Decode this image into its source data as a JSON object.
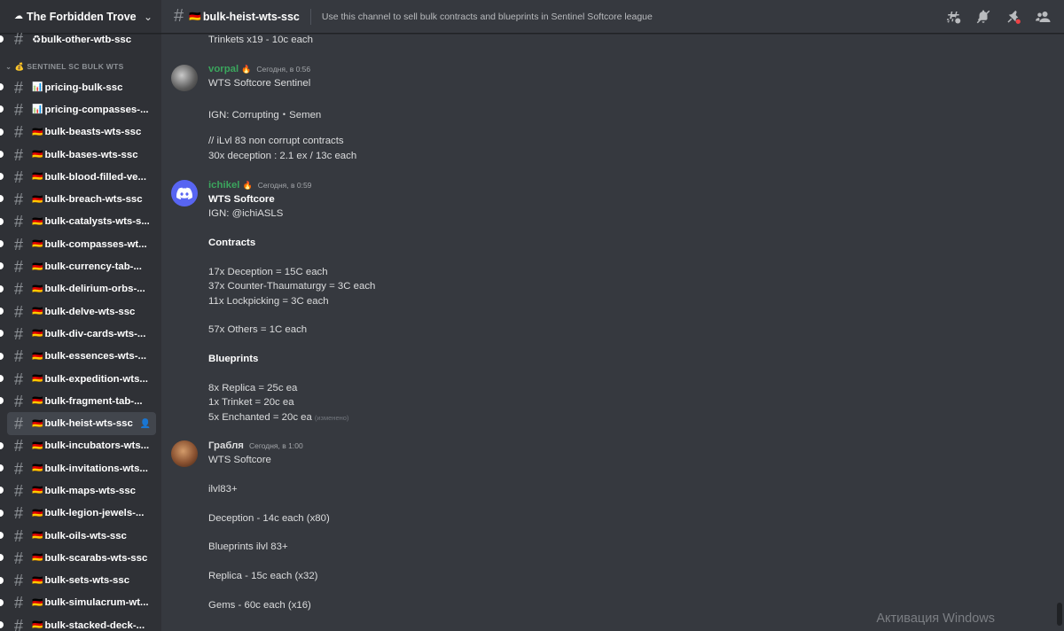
{
  "server": {
    "name": "The Forbidden Trove"
  },
  "sidebar": {
    "top_channel": {
      "name": "♻bulk-other-wtb-ssc"
    },
    "category": "SENTINEL SC BULK WTS",
    "channels": [
      {
        "emoji": "📊",
        "name": "pricing-bulk-ssc"
      },
      {
        "emoji": "📊",
        "name": "pricing-compasses-..."
      },
      {
        "emoji": "🇩🇪",
        "name": "bulk-beasts-wts-ssc"
      },
      {
        "emoji": "🇩🇪",
        "name": "bulk-bases-wts-ssc"
      },
      {
        "emoji": "🇩🇪",
        "name": "bulk-blood-filled-ve..."
      },
      {
        "emoji": "🇩🇪",
        "name": "bulk-breach-wts-ssc"
      },
      {
        "emoji": "🇩🇪",
        "name": "bulk-catalysts-wts-s..."
      },
      {
        "emoji": "🇩🇪",
        "name": "bulk-compasses-wt..."
      },
      {
        "emoji": "🇩🇪",
        "name": "bulk-currency-tab-..."
      },
      {
        "emoji": "🇩🇪",
        "name": "bulk-delirium-orbs-..."
      },
      {
        "emoji": "🇩🇪",
        "name": "bulk-delve-wts-ssc"
      },
      {
        "emoji": "🇩🇪",
        "name": "bulk-div-cards-wts-..."
      },
      {
        "emoji": "🇩🇪",
        "name": "bulk-essences-wts-..."
      },
      {
        "emoji": "🇩🇪",
        "name": "bulk-expedition-wts..."
      },
      {
        "emoji": "🇩🇪",
        "name": "bulk-fragment-tab-..."
      },
      {
        "emoji": "🇩🇪",
        "name": "bulk-heist-wts-ssc",
        "active": true
      },
      {
        "emoji": "🇩🇪",
        "name": "bulk-incubators-wts..."
      },
      {
        "emoji": "🇩🇪",
        "name": "bulk-invitations-wts..."
      },
      {
        "emoji": "🇩🇪",
        "name": "bulk-maps-wts-ssc"
      },
      {
        "emoji": "🇩🇪",
        "name": "bulk-legion-jewels-..."
      },
      {
        "emoji": "🇩🇪",
        "name": "bulk-oils-wts-ssc"
      },
      {
        "emoji": "🇩🇪",
        "name": "bulk-scarabs-wts-ssc"
      },
      {
        "emoji": "🇩🇪",
        "name": "bulk-sets-wts-ssc"
      },
      {
        "emoji": "🇩🇪",
        "name": "bulk-simulacrum-wt..."
      },
      {
        "emoji": "🇩🇪",
        "name": "bulk-stacked-deck-..."
      }
    ]
  },
  "topbar": {
    "channel_emoji": "🇩🇪",
    "channel_name": "bulk-heist-wts-ssc",
    "topic": "Use this channel to sell bulk contracts and blueprints in Sentinel Softcore league",
    "icons": [
      "threads-icon",
      "mute-icon",
      "pin-icon",
      "members-icon"
    ]
  },
  "messages": {
    "prev_tail": "Trinkets x19 - 10c each",
    "m1": {
      "author": "vorpal",
      "author_color": "#3ba55d",
      "timestamp": "Сегодня, в 0:56",
      "lines": [
        "WTS Softcore Sentinel",
        "IGN: Corrupting・Semen",
        "// iLvl 83 non corrupt contracts",
        "30x deception : 2.1 ex / 13c each"
      ]
    },
    "m2": {
      "author": "ichikel",
      "author_color": "#3ba55d",
      "timestamp": "Сегодня, в 0:59",
      "lines": [
        "WTS Softcore",
        "IGN: @ichiASLS",
        "Contracts",
        "17x Deception = 15C each",
        "37x Counter-Thaumaturgy = 3C each",
        "11x Lockpicking = 3C each",
        "57x Others = 1C each",
        "Blueprints",
        "8x Replica = 25c ea",
        "1x Trinket = 20c ea",
        "5x Enchanted = 20c ea"
      ],
      "edited": "(изменено)"
    },
    "m3": {
      "author": "Грабля",
      "author_color": "#dcddde",
      "timestamp": "Сегодня, в 1:00",
      "lines": [
        "WTS Softcore",
        "ilvl83+",
        "Deception - 14c each (x80)",
        "Blueprints ilvl 83+",
        "Replica - 15c each (x32)",
        "Gems - 60c each (x16)"
      ]
    }
  },
  "watermark": "Активация Windows"
}
